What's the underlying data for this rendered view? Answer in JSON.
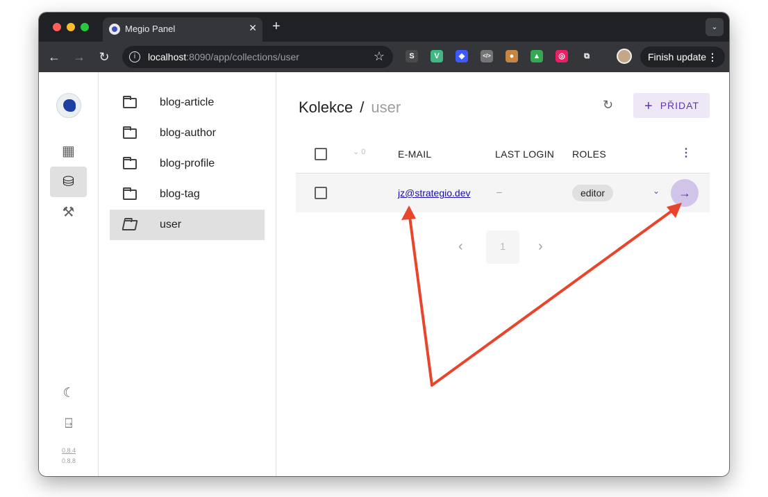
{
  "browser": {
    "tab_title": "Megio Panel",
    "tab_close": "✕",
    "new_tab": "+",
    "tab_search": "⌄",
    "url_host": "localhost",
    "url_rest": ":8090/app/collections/user",
    "finish_update": "Finish update",
    "extensions": [
      {
        "icon": "s-extension-icon",
        "color": "#4a4a4a",
        "glyph": "S"
      },
      {
        "icon": "vue-devtools-icon",
        "color": "#41b883",
        "glyph": "V"
      },
      {
        "icon": "tag-extension-icon",
        "color": "#3d5afe",
        "glyph": "◆"
      },
      {
        "icon": "code-extension-icon",
        "color": "#757575",
        "glyph": "</>"
      },
      {
        "icon": "cookie-extension-icon",
        "color": "#c68642",
        "glyph": "●"
      },
      {
        "icon": "thumb-extension-icon",
        "color": "#34a853",
        "glyph": "▲"
      },
      {
        "icon": "color-extension-icon",
        "color": "#e91e63",
        "glyph": "◎"
      },
      {
        "icon": "puzzle-extensions-icon",
        "color": "#35363a",
        "glyph": "⧉"
      }
    ]
  },
  "app": {
    "rail": {
      "version_current": "0.8.4",
      "version_latest": "0.8.8"
    },
    "collections": [
      {
        "label": "blog-article",
        "active": false
      },
      {
        "label": "blog-author",
        "active": false
      },
      {
        "label": "blog-profile",
        "active": false
      },
      {
        "label": "blog-tag",
        "active": false
      },
      {
        "label": "user",
        "active": true
      }
    ],
    "breadcrumb": {
      "root": "Kolekce",
      "separator": "/",
      "collection": "user"
    },
    "add_button": "PŘIDAT",
    "table": {
      "sort_count": "0",
      "columns": [
        "E-MAIL",
        "LAST LOGIN",
        "ROLES"
      ],
      "rows": [
        {
          "email": "jz@strategio.dev",
          "last_login": "–",
          "roles": [
            "editor"
          ]
        }
      ]
    },
    "pagination": {
      "current_page": "1"
    }
  },
  "colors": {
    "accent": "#673ab7",
    "accent_light": "#ede7f6",
    "annotation_arrow": "#e8452c"
  }
}
